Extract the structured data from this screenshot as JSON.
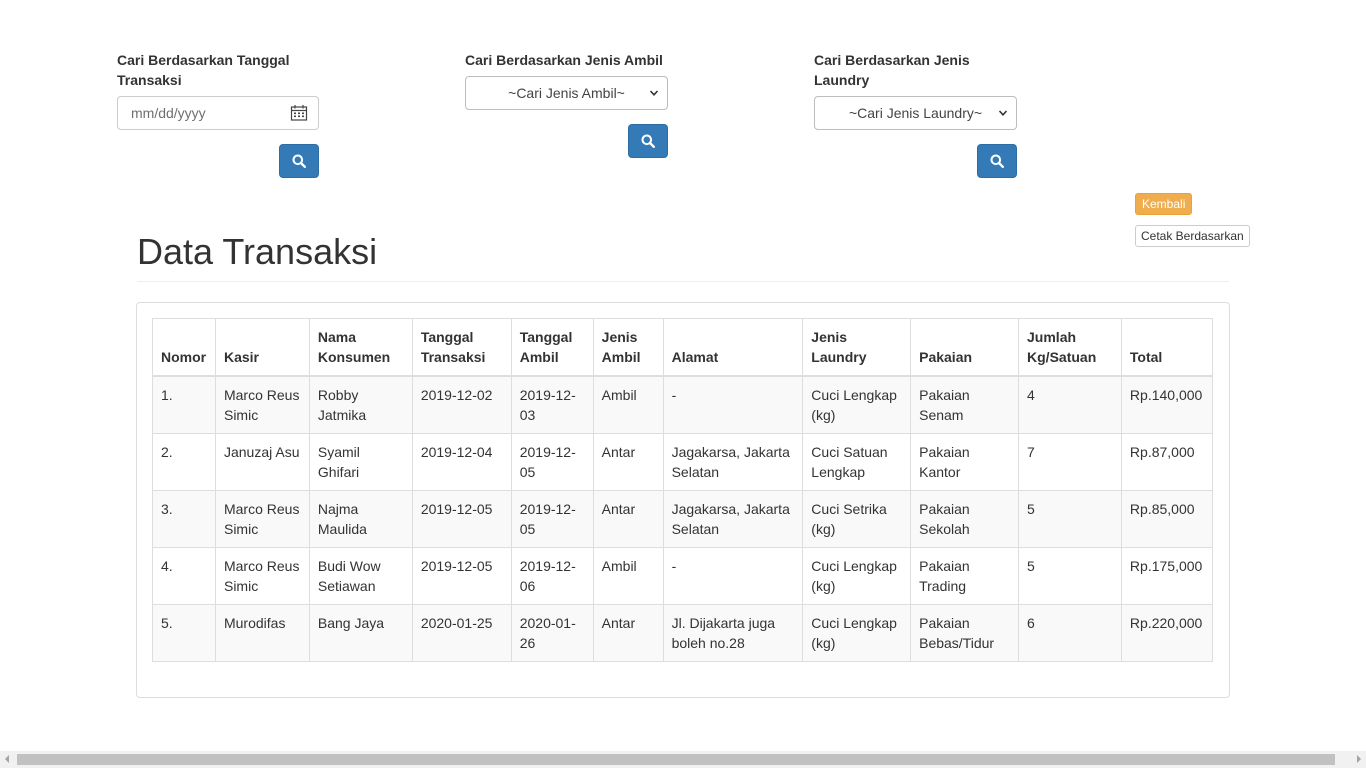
{
  "filters": {
    "date": {
      "label": "Cari Berdasarkan Tanggal Transaksi",
      "placeholder": "mm/dd/yyyy"
    },
    "jenis_ambil": {
      "label": "Cari Berdasarkan Jenis Ambil",
      "selected": "~Cari Jenis Ambil~"
    },
    "jenis_laundry": {
      "label": "Cari Berdasarkan Jenis Laundry",
      "selected": "~Cari Jenis Laundry~"
    }
  },
  "actions": {
    "kembali": "Kembali",
    "cetak": "Cetak Berdasarkan"
  },
  "page_title": "Data Transaksi",
  "table": {
    "headers": [
      "Nomor",
      "Kasir",
      "Nama Konsumen",
      "Tanggal Transaksi",
      "Tanggal Ambil",
      "Jenis Ambil",
      "Alamat",
      "Jenis Laundry",
      "Pakaian",
      "Jumlah Kg/Satuan",
      "Total"
    ],
    "rows": [
      [
        "1.",
        "Marco Reus Simic",
        "Robby Jatmika",
        "2019-12-02",
        "2019-12-03",
        "Ambil",
        "-",
        "Cuci Lengkap (kg)",
        "Pakaian Senam",
        "4",
        "Rp.140,000"
      ],
      [
        "2.",
        "Januzaj Asu",
        "Syamil Ghifari",
        "2019-12-04",
        "2019-12-05",
        "Antar",
        "Jagakarsa, Jakarta Selatan",
        "Cuci Satuan Lengkap",
        "Pakaian Kantor",
        "7",
        "Rp.87,000"
      ],
      [
        "3.",
        "Marco Reus Simic",
        "Najma Maulida",
        "2019-12-05",
        "2019-12-05",
        "Antar",
        "Jagakarsa, Jakarta Selatan",
        "Cuci Setrika (kg)",
        "Pakaian Sekolah",
        "5",
        "Rp.85,000"
      ],
      [
        "4.",
        "Marco Reus Simic",
        "Budi Wow Setiawan",
        "2019-12-05",
        "2019-12-06",
        "Ambil",
        "-",
        "Cuci Lengkap (kg)",
        "Pakaian Trading",
        "5",
        "Rp.175,000"
      ],
      [
        "5.",
        "Murodifas",
        "Bang Jaya",
        "2020-01-25",
        "2020-01-26",
        "Antar",
        "Jl. Dijakarta juga boleh no.28",
        "Cuci Lengkap (kg)",
        "Pakaian Bebas/Tidur",
        "6",
        "Rp.220,000"
      ]
    ]
  },
  "icons": {
    "search": "search-icon",
    "calendar": "calendar-icon",
    "dropdown": "chevron-down-icon"
  },
  "colors": {
    "primary": "#337ab7",
    "warning": "#f0ad4e"
  }
}
